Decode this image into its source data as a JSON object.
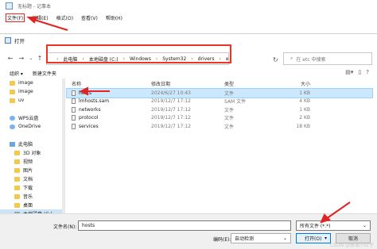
{
  "notepad": {
    "title": "无标题 - 记事本",
    "menu": [
      "文件(F)",
      "编辑(E)",
      "格式(O)",
      "查看(V)",
      "帮助(H)"
    ]
  },
  "dialog": {
    "title": "打开",
    "address": [
      "此电脑",
      "本地磁盘 (C:)",
      "Windows",
      "System32",
      "drivers",
      "etc"
    ],
    "search_placeholder": "在 etc 中搜索",
    "toolbar": {
      "organize": "组织 ▾",
      "new_folder": "新建文件夹"
    },
    "sidebar": [
      {
        "label": "image",
        "icon": "folder-icon"
      },
      {
        "label": "image",
        "icon": "folder-icon"
      },
      {
        "label": "uv",
        "icon": "folder-icon"
      },
      {
        "label": "",
        "icon": ""
      },
      {
        "label": "WPS云盘",
        "icon": "cloud-icon"
      },
      {
        "label": "OneDrive",
        "icon": "cloud-icon"
      },
      {
        "label": "",
        "icon": ""
      },
      {
        "label": "此电脑",
        "icon": "pc-icon"
      },
      {
        "label": "3D 对象",
        "icon": "folder-icon"
      },
      {
        "label": "视频",
        "icon": "folder-icon"
      },
      {
        "label": "图片",
        "icon": "folder-icon"
      },
      {
        "label": "文档",
        "icon": "folder-icon"
      },
      {
        "label": "下载",
        "icon": "folder-icon"
      },
      {
        "label": "音乐",
        "icon": "folder-icon"
      },
      {
        "label": "桌面",
        "icon": "folder-icon"
      },
      {
        "label": "本地磁盘 (C:)",
        "icon": "drive-icon",
        "selected": true
      }
    ],
    "columns": {
      "name": "名称",
      "date": "修改日期",
      "type": "类型",
      "size": "大小"
    },
    "files": [
      {
        "name": "hosts",
        "date": "2024/6/27 10:43",
        "type": "文件",
        "size": "1 KB",
        "selected": true
      },
      {
        "name": "lmhosts.sam",
        "date": "2019/12/7 17:12",
        "type": "SAM 文件",
        "size": "4 KB"
      },
      {
        "name": "networks",
        "date": "2019/12/7 17:12",
        "type": "文件",
        "size": "1 KB"
      },
      {
        "name": "protocol",
        "date": "2019/12/7 17:12",
        "type": "文件",
        "size": "2 KB"
      },
      {
        "name": "services",
        "date": "2019/12/7 17:12",
        "type": "文件",
        "size": "18 KB"
      }
    ],
    "filename_label": "文件名(N):",
    "filename_value": "hosts",
    "filetype_value": "所有文件 (*.*)",
    "encoding_label": "编码(E):",
    "encoding_value": "自动检测",
    "open_label": "打开(O)",
    "cancel_label": "取消",
    "watermark": "CSDN @蔡德小肚子",
    "accent": "#0078d7",
    "annotation_color": "#e32222"
  }
}
